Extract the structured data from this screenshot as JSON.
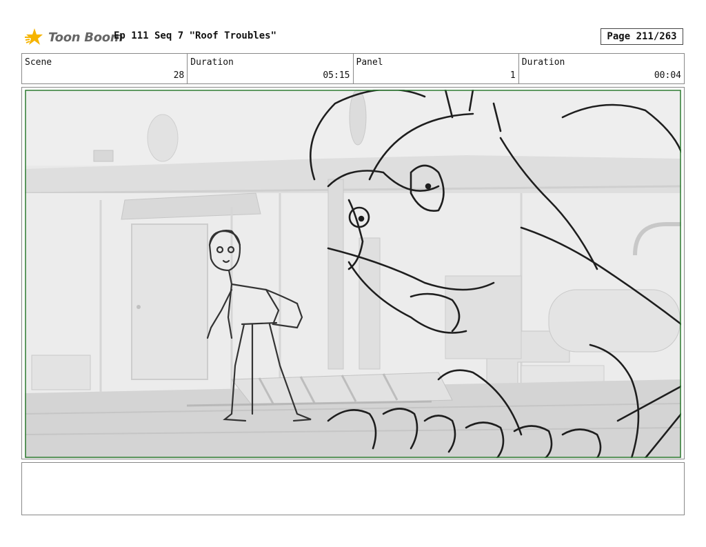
{
  "header": {
    "logo_text": "Toon Boom",
    "title": "Ep 111 Seq 7 \"Roof Troubles\"",
    "page": "Page 211/263"
  },
  "info": {
    "scene_label": "Scene",
    "scene_value": "28",
    "scene_duration_label": "Duration",
    "scene_duration_value": "05:15",
    "panel_label": "Panel",
    "panel_value": "1",
    "panel_duration_label": "Duration",
    "panel_duration_value": "00:04"
  },
  "panel": {
    "icon": "storyboard-panel-image",
    "frame_color": "#2e7d32"
  },
  "notes": {
    "text": ""
  }
}
